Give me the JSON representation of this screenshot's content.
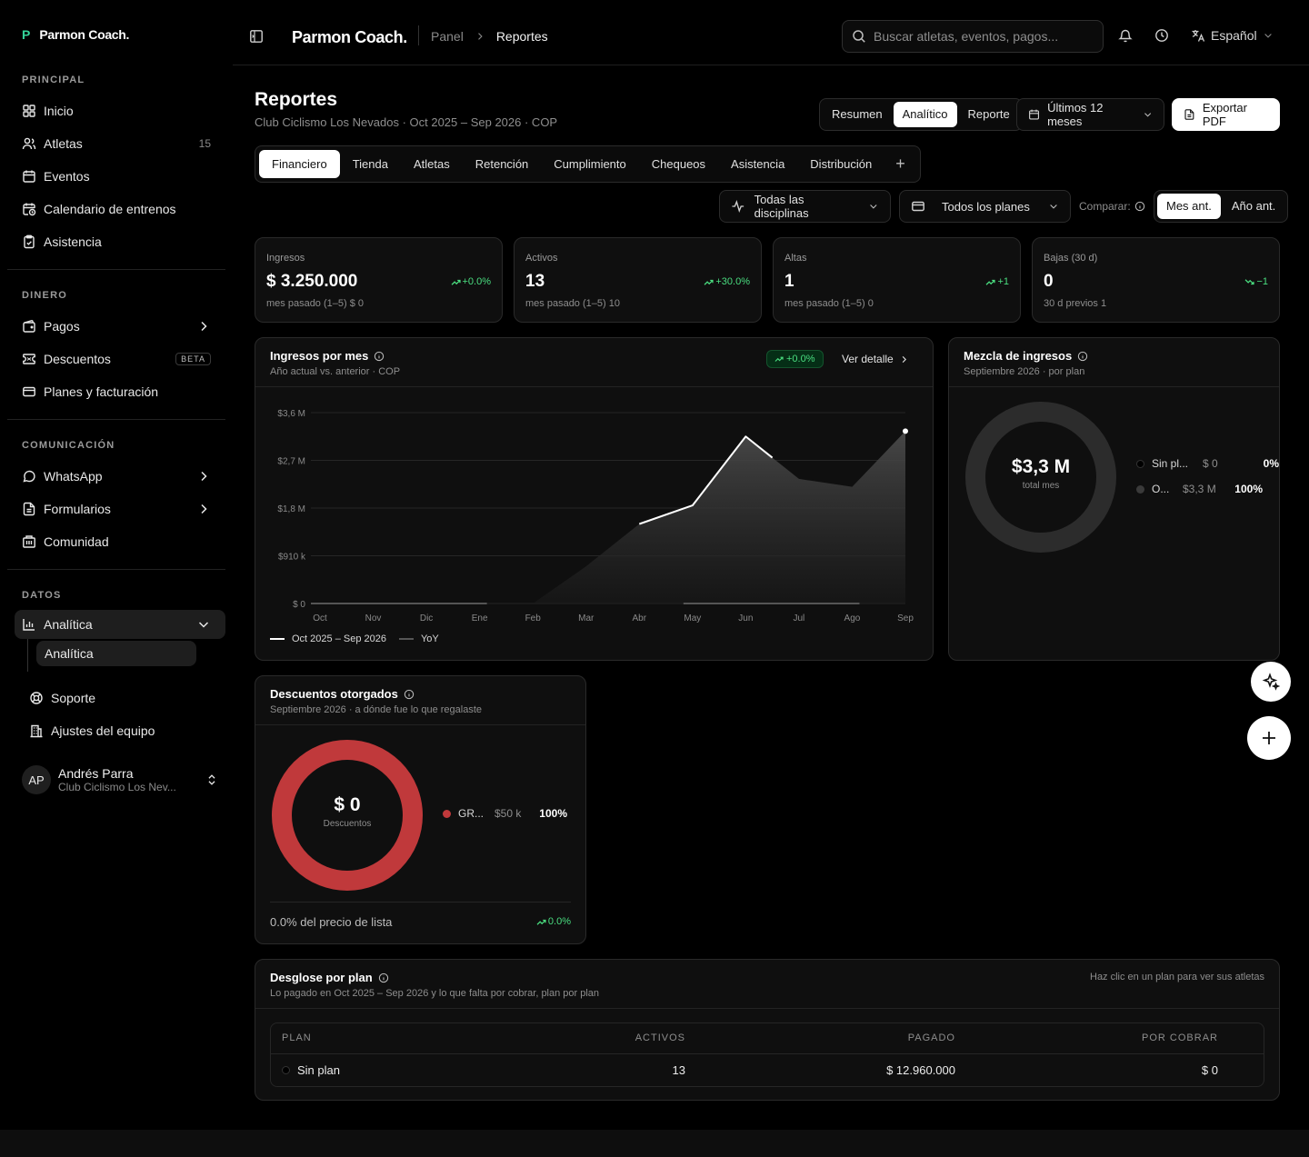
{
  "sidebar": {
    "brand": "Parmon Coach.",
    "sections": [
      {
        "heading": "PRINCIPAL",
        "items": [
          {
            "label": "Inicio",
            "icon": "grid-icon"
          },
          {
            "label": "Atletas",
            "icon": "users-icon",
            "count": "15"
          },
          {
            "label": "Eventos",
            "icon": "calendar-icon"
          },
          {
            "label": "Calendario de entrenos",
            "icon": "calendar-clock-icon"
          },
          {
            "label": "Asistencia",
            "icon": "clipboard-check-icon"
          }
        ]
      },
      {
        "heading": "DINERO",
        "items": [
          {
            "label": "Pagos",
            "icon": "wallet-icon"
          },
          {
            "label": "Descuentos",
            "icon": "ticket-icon",
            "badge": "BETA"
          },
          {
            "label": "Planes y facturación",
            "icon": "credit-card-icon"
          }
        ]
      },
      {
        "heading": "COMUNICACIÓN",
        "items": [
          {
            "label": "WhatsApp",
            "icon": "message-circle-icon"
          },
          {
            "label": "Formularios",
            "icon": "file-text-icon"
          },
          {
            "label": "Comunidad",
            "icon": "building-icon"
          }
        ]
      },
      {
        "heading": "DATOS",
        "items": [
          {
            "label": "Analítica",
            "icon": "bar-chart-icon",
            "sub": "Analítica"
          }
        ]
      }
    ],
    "footer_items": [
      {
        "label": "Soporte",
        "icon": "life-buoy-icon"
      },
      {
        "label": "Ajustes del equipo",
        "icon": "building-2-icon"
      }
    ],
    "user": {
      "initials": "AP",
      "name": "Andrés Parra",
      "org": "Club Ciclismo Los Nev..."
    }
  },
  "topbar": {
    "brand": "Parmon Coach.",
    "breadcrumb": [
      "Panel",
      "Reportes"
    ],
    "search_placeholder": "Buscar atletas, eventos, pagos...",
    "language": "Español"
  },
  "page": {
    "title": "Reportes",
    "subtitle": "Club Ciclismo Los Nevados · Oct 2025 – Sep 2026 · COP",
    "view_modes": [
      "Resumen",
      "Analítico",
      "Reporte"
    ],
    "view_active": "Analítico",
    "period": "Últimos 12 meses",
    "export": "Exportar PDF",
    "tabs": [
      "Financiero",
      "Tienda",
      "Atletas",
      "Retención",
      "Cumplimiento",
      "Chequeos",
      "Asistencia",
      "Distribución"
    ],
    "tab_active": "Financiero",
    "filters": {
      "discipline": "Todas las disciplinas",
      "plan": "Todos los planes",
      "compare_label": "Comparar:",
      "compare_options": [
        "Mes ant.",
        "Año ant."
      ],
      "compare_active": "Mes ant."
    }
  },
  "kpis": [
    {
      "label": "Ingresos",
      "value": "$ 3.250.000",
      "delta": "+0.0%",
      "foot": "mes pasado (1–5) $ 0"
    },
    {
      "label": "Activos",
      "value": "13",
      "delta": "+30.0%",
      "foot": "mes pasado (1–5) 10"
    },
    {
      "label": "Altas",
      "value": "1",
      "delta": "+1",
      "foot": "mes pasado (1–5) 0"
    },
    {
      "label": "Bajas (30 d)",
      "value": "0",
      "delta": "−1",
      "foot": "30 d previos 1"
    }
  ],
  "revenue_chart": {
    "title": "Ingresos por mes",
    "subtitle": "Año actual vs. anterior · COP",
    "delta": "+0.0%",
    "link": "Ver detalle",
    "legend": [
      "Oct 2025 – Sep 2026",
      "YoY"
    ]
  },
  "chart_data": {
    "type": "area",
    "categories": [
      "Oct",
      "Nov",
      "Dic",
      "Ene",
      "Feb",
      "Mar",
      "Abr",
      "May",
      "Jun",
      "Jul",
      "Ago",
      "Sep"
    ],
    "y_ticks": [
      "$ 0",
      "$910 k",
      "$1,8 M",
      "$2,7 M",
      "$3,6 M"
    ],
    "ylim": [
      0,
      3600000
    ],
    "series": [
      {
        "name": "Oct 2025 – Sep 2026",
        "values": [
          0,
          0,
          0,
          0,
          0,
          700000,
          1500000,
          1850000,
          3150000,
          2350000,
          2200000,
          3250000
        ]
      },
      {
        "name": "YoY",
        "values": [
          0,
          0,
          0,
          0,
          null,
          null,
          null,
          0,
          0,
          0,
          0,
          null
        ]
      }
    ],
    "grid": true,
    "legend_position": "bottom-left"
  },
  "mix": {
    "title": "Mezcla de ingresos",
    "subtitle": "Septiembre 2026 · por plan",
    "center_value": "$3,3 M",
    "center_label": "total mes",
    "rows": [
      {
        "name": "Sin pl...",
        "amount": "$ 0",
        "pct": "0%",
        "color": "#000000"
      },
      {
        "name": "O...",
        "amount": "$3,3 M",
        "pct": "100%",
        "color": "#3a3a3a"
      }
    ]
  },
  "discounts": {
    "title": "Descuentos otorgados",
    "subtitle": "Septiembre 2026 · a dónde fue lo que regalaste",
    "center_value": "$ 0",
    "center_label": "Descuentos",
    "rows": [
      {
        "name": "GR...",
        "amount": "$50 k",
        "pct": "100%",
        "color": "#c0393b"
      }
    ],
    "footer": "0.0% del precio de lista",
    "footer_delta": "0.0%"
  },
  "breakdown": {
    "title": "Desglose por plan",
    "subtitle": "Lo pagado en Oct 2025 – Sep 2026 y lo que falta por cobrar, plan por plan",
    "hint": "Haz clic en un plan para ver sus atletas",
    "columns": [
      "PLAN",
      "ACTIVOS",
      "PAGADO",
      "POR COBRAR"
    ],
    "rows": [
      {
        "plan": "Sin plan",
        "activos": "13",
        "pagado": "$ 12.960.000",
        "por_cobrar": "$ 0"
      }
    ]
  }
}
